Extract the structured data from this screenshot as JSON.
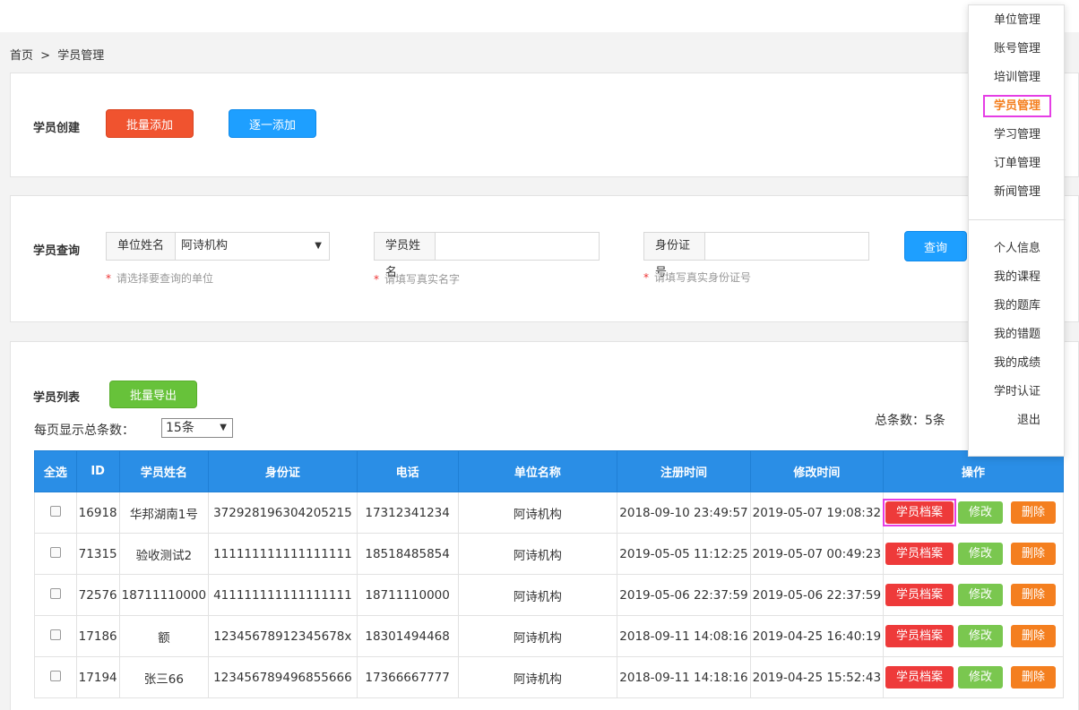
{
  "breadcrumb": {
    "home": "首页",
    "sep": ">",
    "current": "学员管理"
  },
  "create": {
    "label": "学员创建",
    "batch_add": "批量添加",
    "single_add": "逐一添加"
  },
  "query": {
    "label": "学员查询",
    "unit_label": "单位姓名",
    "unit_value": "阿诗机构",
    "unit_hint": "请选择要查询的单位",
    "name_label": "学员姓名",
    "name_value": "",
    "name_hint": "请填写真实名字",
    "id_label": "身份证号",
    "id_value": "",
    "id_hint": "请填写真实身份证号",
    "search_button": "查询",
    "required_mark": "*"
  },
  "list": {
    "label": "学员列表",
    "export_button": "批量导出",
    "per_page_label": "每页显示总条数：",
    "per_page_value": "15条",
    "total_label": "总条数：5条",
    "columns": [
      "全选",
      "ID",
      "学员姓名",
      "身份证",
      "电话",
      "单位名称",
      "注册时间",
      "修改时间",
      "操作"
    ],
    "rows": [
      {
        "id": "16918",
        "name": "华邦湖南1号",
        "idcard": "372928196304205215",
        "phone": "17312341234",
        "unit": "阿诗机构",
        "reg": "2018-09-10 23:49:57",
        "mod": "2019-05-07 19:08:32"
      },
      {
        "id": "71315",
        "name": "验收测试2",
        "idcard": "111111111111111111",
        "phone": "18518485854",
        "unit": "阿诗机构",
        "reg": "2019-05-05 11:12:25",
        "mod": "2019-05-07 00:49:23"
      },
      {
        "id": "72576",
        "name": "18711110000",
        "idcard": "411111111111111111",
        "phone": "18711110000",
        "unit": "阿诗机构",
        "reg": "2019-05-06 22:37:59",
        "mod": "2019-05-06 22:37:59"
      },
      {
        "id": "17186",
        "name": "额",
        "idcard": "12345678912345678x",
        "phone": "18301494468",
        "unit": "阿诗机构",
        "reg": "2018-09-11 14:08:16",
        "mod": "2019-04-25 16:40:19"
      },
      {
        "id": "17194",
        "name": "张三66",
        "idcard": "123456789496855666",
        "phone": "17366667777",
        "unit": "阿诗机构",
        "reg": "2018-09-11 14:18:16",
        "mod": "2019-04-25 15:52:43"
      }
    ],
    "ops": {
      "archive": "学员档案",
      "edit": "修改",
      "delete": "删除"
    }
  },
  "menu": {
    "items": [
      "单位管理",
      "账号管理",
      "培训管理",
      "学员管理",
      "学习管理",
      "订单管理",
      "新闻管理"
    ],
    "active_index": 3,
    "items2": [
      "个人信息",
      "我的课程",
      "我的题库",
      "我的错题",
      "我的成绩",
      "学时认证",
      "退出"
    ]
  },
  "colors": {
    "header_blue": "#2a8ee6",
    "accent_orange": "#f47f1f",
    "highlight_magenta": "#e53ee5"
  }
}
